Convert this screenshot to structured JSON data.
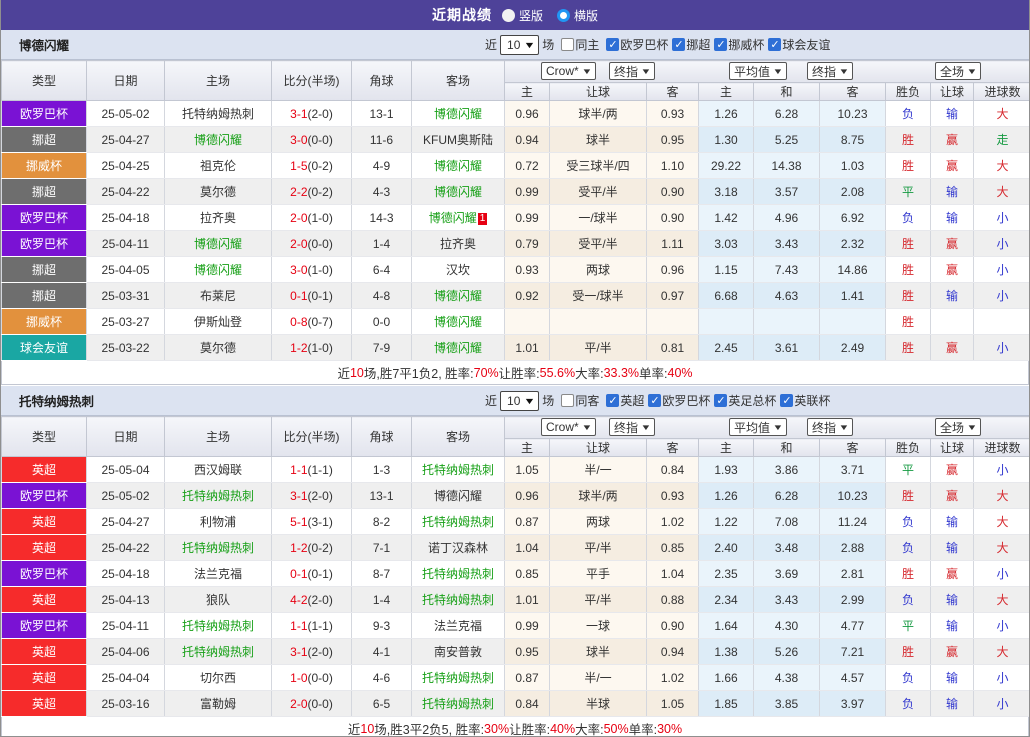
{
  "title_bar": {
    "title": "近期战绩",
    "view_options": [
      {
        "label": "竖版",
        "selected": false
      },
      {
        "label": "横版",
        "selected": true
      }
    ]
  },
  "table_header": {
    "left_cols": [
      "类型",
      "日期",
      "主场",
      "比分(半场)",
      "角球",
      "客场"
    ],
    "dropdowns": {
      "book": "Crow*",
      "final1": "终指",
      "avg": "平均值",
      "final2": "终指",
      "full": "全场"
    },
    "odds_cols": [
      "主",
      "让球",
      "客"
    ],
    "avg_cols": [
      "主",
      "和",
      "客"
    ],
    "result_cols": [
      "胜负",
      "让球",
      "进球数"
    ]
  },
  "league_colors": {
    "欧罗巴杯": "#7a12d4",
    "挪超": "#6e6e6e",
    "挪威杯": "#e2913d",
    "球会友谊": "#1aa7a3",
    "英超": "#f62b2b"
  },
  "result_colors": {
    "胜": "#d6282e",
    "赢": "#d6282e",
    "大": "#d6282e",
    "平": "#169a42",
    "走": "#169a42",
    "负": "#3238cf",
    "输": "#3238cf",
    "小": "#3238cf"
  },
  "tables": [
    {
      "team": "博德闪耀",
      "filter": {
        "near": "近",
        "count": "10",
        "games": "场",
        "same_label": "同主",
        "same_checked": false,
        "leagues": [
          {
            "label": "欧罗巴杯",
            "checked": true
          },
          {
            "label": "挪超",
            "checked": true
          },
          {
            "label": "挪威杯",
            "checked": true
          },
          {
            "label": "球会友谊",
            "checked": true
          }
        ]
      },
      "rows": [
        {
          "league": "欧罗巴杯",
          "date": "25-05-02",
          "home": "托特纳姆热刺",
          "hh": false,
          "score": "3-1",
          "half": "(2-0)",
          "corner": "13-1",
          "away": "博德闪耀",
          "ah": true,
          "badge": "",
          "o": [
            "0.96",
            "球半/两",
            "0.93"
          ],
          "a": [
            "1.26",
            "6.28",
            "10.23"
          ],
          "r": [
            "负",
            "输",
            "大"
          ]
        },
        {
          "league": "挪超",
          "date": "25-04-27",
          "home": "博德闪耀",
          "hh": true,
          "score": "3-0",
          "half": "(0-0)",
          "corner": "11-6",
          "away": "KFUM奥斯陆",
          "ah": false,
          "badge": "",
          "o": [
            "0.94",
            "球半",
            "0.95"
          ],
          "a": [
            "1.30",
            "5.25",
            "8.75"
          ],
          "r": [
            "胜",
            "赢",
            "走"
          ]
        },
        {
          "league": "挪威杯",
          "date": "25-04-25",
          "home": "祖克伦",
          "hh": false,
          "score": "1-5",
          "half": "(0-2)",
          "corner": "4-9",
          "away": "博德闪耀",
          "ah": true,
          "badge": "",
          "o": [
            "0.72",
            "受三球半/四",
            "1.10"
          ],
          "a": [
            "29.22",
            "14.38",
            "1.03"
          ],
          "r": [
            "胜",
            "赢",
            "大"
          ]
        },
        {
          "league": "挪超",
          "date": "25-04-22",
          "home": "莫尔德",
          "hh": false,
          "score": "2-2",
          "half": "(0-2)",
          "corner": "4-3",
          "away": "博德闪耀",
          "ah": true,
          "badge": "",
          "o": [
            "0.99",
            "受平/半",
            "0.90"
          ],
          "a": [
            "3.18",
            "3.57",
            "2.08"
          ],
          "r": [
            "平",
            "输",
            "大"
          ]
        },
        {
          "league": "欧罗巴杯",
          "date": "25-04-18",
          "home": "拉齐奥",
          "hh": false,
          "score": "2-0",
          "half": "(1-0)",
          "corner": "14-3",
          "away": "博德闪耀",
          "ah": true,
          "badge": "1",
          "o": [
            "0.99",
            "一/球半",
            "0.90"
          ],
          "a": [
            "1.42",
            "4.96",
            "6.92"
          ],
          "r": [
            "负",
            "输",
            "小"
          ]
        },
        {
          "league": "欧罗巴杯",
          "date": "25-04-11",
          "home": "博德闪耀",
          "hh": true,
          "score": "2-0",
          "half": "(0-0)",
          "corner": "1-4",
          "away": "拉齐奥",
          "ah": false,
          "badge": "",
          "o": [
            "0.79",
            "受平/半",
            "1.11"
          ],
          "a": [
            "3.03",
            "3.43",
            "2.32"
          ],
          "r": [
            "胜",
            "赢",
            "小"
          ]
        },
        {
          "league": "挪超",
          "date": "25-04-05",
          "home": "博德闪耀",
          "hh": true,
          "score": "3-0",
          "half": "(1-0)",
          "corner": "6-4",
          "away": "汉坎",
          "ah": false,
          "badge": "",
          "o": [
            "0.93",
            "两球",
            "0.96"
          ],
          "a": [
            "1.15",
            "7.43",
            "14.86"
          ],
          "r": [
            "胜",
            "赢",
            "小"
          ]
        },
        {
          "league": "挪超",
          "date": "25-03-31",
          "home": "布莱尼",
          "hh": false,
          "score": "0-1",
          "half": "(0-1)",
          "corner": "4-8",
          "away": "博德闪耀",
          "ah": true,
          "badge": "",
          "o": [
            "0.92",
            "受一/球半",
            "0.97"
          ],
          "a": [
            "6.68",
            "4.63",
            "1.41"
          ],
          "r": [
            "胜",
            "输",
            "小"
          ]
        },
        {
          "league": "挪威杯",
          "date": "25-03-27",
          "home": "伊斯灿登",
          "hh": false,
          "score": "0-8",
          "half": "(0-7)",
          "corner": "0-0",
          "away": "博德闪耀",
          "ah": true,
          "badge": "",
          "o": [
            "",
            "",
            ""
          ],
          "a": [
            "",
            "",
            ""
          ],
          "r": [
            "胜",
            "",
            ""
          ]
        },
        {
          "league": "球会友谊",
          "date": "25-03-22",
          "home": "莫尔德",
          "hh": false,
          "score": "1-2",
          "half": "(1-0)",
          "corner": "7-9",
          "away": "博德闪耀",
          "ah": true,
          "badge": "",
          "o": [
            "1.01",
            "平/半",
            "0.81"
          ],
          "a": [
            "2.45",
            "3.61",
            "2.49"
          ],
          "r": [
            "胜",
            "赢",
            "小"
          ]
        }
      ],
      "summary": [
        {
          "t": "近",
          "r": false
        },
        {
          "t": "10",
          "r": true
        },
        {
          "t": "场,胜7平1负2, 胜率:",
          "r": false
        },
        {
          "t": "70%",
          "r": true
        },
        {
          "t": " 让胜率:",
          "r": false
        },
        {
          "t": "55.6%",
          "r": true
        },
        {
          "t": " 大率:",
          "r": false
        },
        {
          "t": "33.3%",
          "r": true
        },
        {
          "t": " 单率:",
          "r": false
        },
        {
          "t": "40%",
          "r": true
        }
      ]
    },
    {
      "team": "托特纳姆热刺",
      "filter": {
        "near": "近",
        "count": "10",
        "games": "场",
        "same_label": "同客",
        "same_checked": false,
        "leagues": [
          {
            "label": "英超",
            "checked": true
          },
          {
            "label": "欧罗巴杯",
            "checked": true
          },
          {
            "label": "英足总杯",
            "checked": true
          },
          {
            "label": "英联杯",
            "checked": true
          }
        ]
      },
      "rows": [
        {
          "league": "英超",
          "date": "25-05-04",
          "home": "西汉姆联",
          "hh": false,
          "score": "1-1",
          "half": "(1-1)",
          "corner": "1-3",
          "away": "托特纳姆热刺",
          "ah": true,
          "badge": "",
          "o": [
            "1.05",
            "半/一",
            "0.84"
          ],
          "a": [
            "1.93",
            "3.86",
            "3.71"
          ],
          "r": [
            "平",
            "赢",
            "小"
          ]
        },
        {
          "league": "欧罗巴杯",
          "date": "25-05-02",
          "home": "托特纳姆热刺",
          "hh": true,
          "score": "3-1",
          "half": "(2-0)",
          "corner": "13-1",
          "away": "博德闪耀",
          "ah": false,
          "badge": "",
          "o": [
            "0.96",
            "球半/两",
            "0.93"
          ],
          "a": [
            "1.26",
            "6.28",
            "10.23"
          ],
          "r": [
            "胜",
            "赢",
            "大"
          ]
        },
        {
          "league": "英超",
          "date": "25-04-27",
          "home": "利物浦",
          "hh": false,
          "score": "5-1",
          "half": "(3-1)",
          "corner": "8-2",
          "away": "托特纳姆热刺",
          "ah": true,
          "badge": "",
          "o": [
            "0.87",
            "两球",
            "1.02"
          ],
          "a": [
            "1.22",
            "7.08",
            "11.24"
          ],
          "r": [
            "负",
            "输",
            "大"
          ]
        },
        {
          "league": "英超",
          "date": "25-04-22",
          "home": "托特纳姆热刺",
          "hh": true,
          "score": "1-2",
          "half": "(0-2)",
          "corner": "7-1",
          "away": "诺丁汉森林",
          "ah": false,
          "badge": "",
          "o": [
            "1.04",
            "平/半",
            "0.85"
          ],
          "a": [
            "2.40",
            "3.48",
            "2.88"
          ],
          "r": [
            "负",
            "输",
            "大"
          ]
        },
        {
          "league": "欧罗巴杯",
          "date": "25-04-18",
          "home": "法兰克福",
          "hh": false,
          "score": "0-1",
          "half": "(0-1)",
          "corner": "8-7",
          "away": "托特纳姆热刺",
          "ah": true,
          "badge": "",
          "o": [
            "0.85",
            "平手",
            "1.04"
          ],
          "a": [
            "2.35",
            "3.69",
            "2.81"
          ],
          "r": [
            "胜",
            "赢",
            "小"
          ]
        },
        {
          "league": "英超",
          "date": "25-04-13",
          "home": "狼队",
          "hh": false,
          "score": "4-2",
          "half": "(2-0)",
          "corner": "1-4",
          "away": "托特纳姆热刺",
          "ah": true,
          "badge": "",
          "o": [
            "1.01",
            "平/半",
            "0.88"
          ],
          "a": [
            "2.34",
            "3.43",
            "2.99"
          ],
          "r": [
            "负",
            "输",
            "大"
          ]
        },
        {
          "league": "欧罗巴杯",
          "date": "25-04-11",
          "home": "托特纳姆热刺",
          "hh": true,
          "score": "1-1",
          "half": "(1-1)",
          "corner": "9-3",
          "away": "法兰克福",
          "ah": false,
          "badge": "",
          "o": [
            "0.99",
            "一球",
            "0.90"
          ],
          "a": [
            "1.64",
            "4.30",
            "4.77"
          ],
          "r": [
            "平",
            "输",
            "小"
          ]
        },
        {
          "league": "英超",
          "date": "25-04-06",
          "home": "托特纳姆热刺",
          "hh": true,
          "score": "3-1",
          "half": "(2-0)",
          "corner": "4-1",
          "away": "南安普敦",
          "ah": false,
          "badge": "",
          "o": [
            "0.95",
            "球半",
            "0.94"
          ],
          "a": [
            "1.38",
            "5.26",
            "7.21"
          ],
          "r": [
            "胜",
            "赢",
            "大"
          ]
        },
        {
          "league": "英超",
          "date": "25-04-04",
          "home": "切尔西",
          "hh": false,
          "score": "1-0",
          "half": "(0-0)",
          "corner": "4-6",
          "away": "托特纳姆热刺",
          "ah": true,
          "badge": "",
          "o": [
            "0.87",
            "半/一",
            "1.02"
          ],
          "a": [
            "1.66",
            "4.38",
            "4.57"
          ],
          "r": [
            "负",
            "输",
            "小"
          ]
        },
        {
          "league": "英超",
          "date": "25-03-16",
          "home": "富勒姆",
          "hh": false,
          "score": "2-0",
          "half": "(0-0)",
          "corner": "6-5",
          "away": "托特纳姆热刺",
          "ah": true,
          "badge": "",
          "o": [
            "0.84",
            "半球",
            "1.05"
          ],
          "a": [
            "1.85",
            "3.85",
            "3.97"
          ],
          "r": [
            "负",
            "输",
            "小"
          ]
        }
      ],
      "summary": [
        {
          "t": "近",
          "r": false
        },
        {
          "t": "10",
          "r": true
        },
        {
          "t": "场,胜3平2负5, 胜率:",
          "r": false
        },
        {
          "t": "30%",
          "r": true
        },
        {
          "t": " 让胜率:",
          "r": false
        },
        {
          "t": "40%",
          "r": true
        },
        {
          "t": " 大率:",
          "r": false
        },
        {
          "t": "50%",
          "r": true
        },
        {
          "t": " 单率:",
          "r": false
        },
        {
          "t": "30%",
          "r": true
        }
      ]
    }
  ]
}
